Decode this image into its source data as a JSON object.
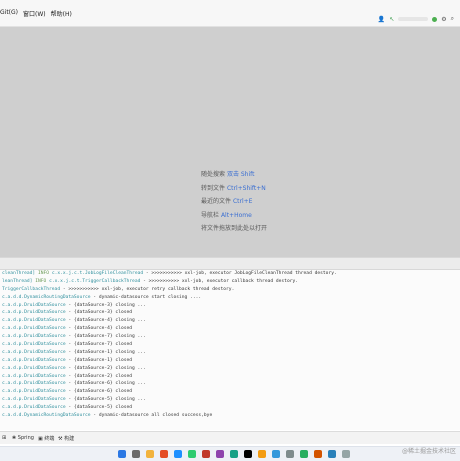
{
  "menu": {
    "items": [
      "Git(G)",
      "窗口(W)",
      "帮助(H)"
    ]
  },
  "hints": [
    {
      "label": "随处搜索",
      "key": "双击 Shift"
    },
    {
      "label": "转到文件",
      "key": "Ctrl+Shift+N"
    },
    {
      "label": "最近的文件",
      "key": "Ctrl+E"
    },
    {
      "label": "导航栏",
      "key": "Alt+Home"
    },
    {
      "label": "将文件拖放到此处以打开",
      "key": ""
    }
  ],
  "console": {
    "lines": [
      {
        "thread": "cleanThread]",
        "level": "INFO",
        "class": "c.x.x.j.c.t.JobLogFileCleanThread",
        "msg": " - >>>>>>>>>>> xxl-job, executor JobLogFileCleanThread thread destory."
      },
      {
        "thread": "leanThread]",
        "level": "INFO",
        "class": "c.x.x.j.c.t.TriggerCallbackThread",
        "msg": " - >>>>>>>>>>> xxl-job, executor callback thread destory."
      },
      {
        "thread": "",
        "level": "",
        "class": "TriggerCallbackThread",
        "msg": " - >>>>>>>>>>> xxl-job, executor retry callback thread destory."
      },
      {
        "thread": "",
        "level": "",
        "class": "c.a.d.d.DynamicRoutingDataSource",
        "msg": " - dynamic-datasource start closing ...."
      },
      {
        "thread": "",
        "level": "",
        "class": "c.a.d.p.DruidDataSource",
        "msg": " - {dataSource-3} closing ..."
      },
      {
        "thread": "",
        "level": "",
        "class": "c.a.d.p.DruidDataSource",
        "msg": " - {dataSource-3} closed"
      },
      {
        "thread": "",
        "level": "",
        "class": "c.a.d.p.DruidDataSource",
        "msg": " - {dataSource-4} closing ..."
      },
      {
        "thread": "",
        "level": "",
        "class": "c.a.d.p.DruidDataSource",
        "msg": " - {dataSource-4} closed"
      },
      {
        "thread": "",
        "level": "",
        "class": "c.a.d.p.DruidDataSource",
        "msg": " - {dataSource-7} closing ..."
      },
      {
        "thread": "",
        "level": "",
        "class": "c.a.d.p.DruidDataSource",
        "msg": " - {dataSource-7} closed"
      },
      {
        "thread": "",
        "level": "",
        "class": "c.a.d.p.DruidDataSource",
        "msg": " - {dataSource-1} closing ..."
      },
      {
        "thread": "",
        "level": "",
        "class": "c.a.d.p.DruidDataSource",
        "msg": " - {dataSource-1} closed"
      },
      {
        "thread": "",
        "level": "",
        "class": "c.a.d.p.DruidDataSource",
        "msg": " - {dataSource-2} closing ..."
      },
      {
        "thread": "",
        "level": "",
        "class": "c.a.d.p.DruidDataSource",
        "msg": " - {dataSource-2} closed"
      },
      {
        "thread": "",
        "level": "",
        "class": "c.a.d.p.DruidDataSource",
        "msg": " - {dataSource-6} closing ..."
      },
      {
        "thread": "",
        "level": "",
        "class": "c.a.d.p.DruidDataSource",
        "msg": " - {dataSource-6} closed"
      },
      {
        "thread": "",
        "level": "",
        "class": "c.a.d.p.DruidDataSource",
        "msg": " - {dataSource-5} closing ..."
      },
      {
        "thread": "",
        "level": "",
        "class": "c.a.d.p.DruidDataSource",
        "msg": " - {dataSource-5} closed"
      },
      {
        "thread": "",
        "level": "",
        "class": "c.a.d.d.DynamicRoutingDataSource",
        "msg": " - dynamic-datasource all closed success,bye"
      }
    ]
  },
  "bottom_tabs": {
    "spring": "Spring",
    "terminal": "终端",
    "build": "构建"
  },
  "watermark": "@稀土掘金技术社区",
  "colors": {
    "editor_bg": "#cfcfcf",
    "hint_key": "#3b6fd2",
    "log_class": "#2f8f9d"
  }
}
